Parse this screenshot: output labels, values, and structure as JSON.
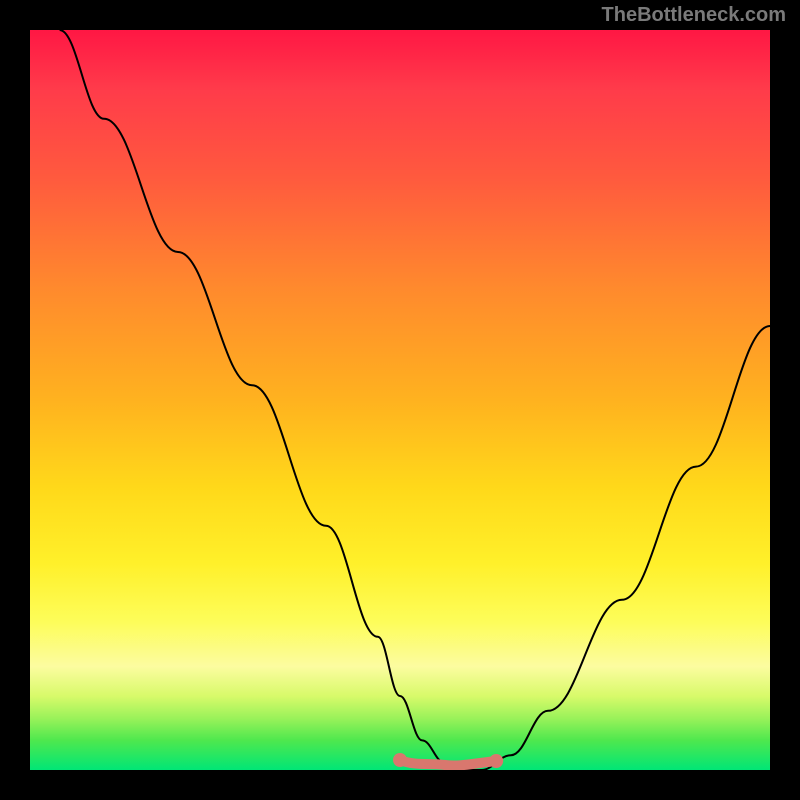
{
  "watermark": "TheBottleneck.com",
  "chart_data": {
    "type": "line",
    "title": "",
    "xlabel": "",
    "ylabel": "",
    "xlim": [
      0,
      100
    ],
    "ylim": [
      0,
      100
    ],
    "series": [
      {
        "name": "curve",
        "x": [
          4,
          10,
          20,
          30,
          40,
          47,
          50,
          53,
          56,
          58,
          61,
          65,
          70,
          80,
          90,
          100
        ],
        "values": [
          100,
          88,
          70,
          52,
          33,
          18,
          10,
          4,
          1,
          0,
          0,
          2,
          8,
          23,
          41,
          60
        ]
      }
    ],
    "annotations": [
      {
        "name": "flat-bottom-highlight",
        "x_start": 50,
        "x_end": 63,
        "y": 0
      }
    ],
    "colors": {
      "curve": "#000000",
      "highlight": "#d9776e",
      "gradient_top": "#ff1744",
      "gradient_bottom": "#00e676"
    }
  }
}
